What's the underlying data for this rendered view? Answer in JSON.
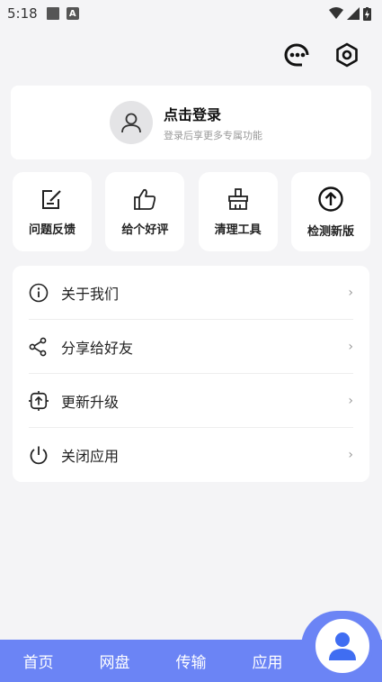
{
  "status": {
    "time": "5:18",
    "notif_letter": "A"
  },
  "user": {
    "login_title": "点击登录",
    "login_sub": "登录后享更多专属功能"
  },
  "actions": [
    {
      "label": "问题反馈",
      "icon": "edit-icon"
    },
    {
      "label": "给个好评",
      "icon": "thumbs-up-icon"
    },
    {
      "label": "清理工具",
      "icon": "broom-icon"
    },
    {
      "label": "检测新版",
      "icon": "upload-circle-icon"
    }
  ],
  "menu": [
    {
      "label": "关于我们",
      "icon": "info-icon"
    },
    {
      "label": "分享给好友",
      "icon": "share-icon"
    },
    {
      "label": "更新升级",
      "icon": "update-icon"
    },
    {
      "label": "关闭应用",
      "icon": "power-icon"
    }
  ],
  "menu_chevron": "›",
  "nav": [
    {
      "label": "首页"
    },
    {
      "label": "网盘"
    },
    {
      "label": "传输"
    },
    {
      "label": "应用"
    }
  ],
  "colors": {
    "accent": "#6b84f5",
    "background": "#f4f4f6"
  }
}
